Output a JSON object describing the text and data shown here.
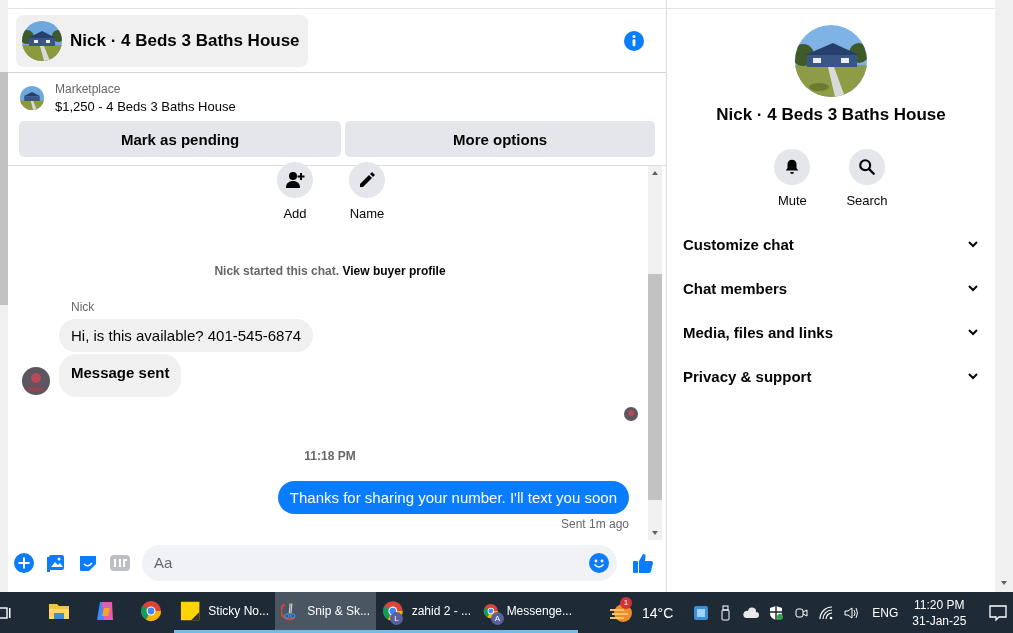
{
  "header": {
    "title": "Nick · 4 Beds 3 Baths House"
  },
  "listing": {
    "source": "Marketplace",
    "summary": "$1,250 - 4 Beds 3 Baths House",
    "buttons": [
      "Mark as pending",
      "More options"
    ]
  },
  "chat_actions": [
    {
      "label": "Add",
      "kind": "add"
    },
    {
      "label": "Name",
      "kind": "name"
    }
  ],
  "notice": {
    "text": "Nick started this chat.",
    "link": "View buyer profile"
  },
  "incoming": {
    "sender": "Nick",
    "messages": [
      {
        "kind": "text",
        "text": "Hi, is this available? 401-545-6874"
      },
      {
        "kind": "status",
        "text": "Message sent"
      }
    ]
  },
  "timestamp": "11:18 PM",
  "outgoing": {
    "text": "Thanks for sharing your number. I'll text you soon",
    "status": "Sent 1m ago"
  },
  "composer": {
    "placeholder": "Aa"
  },
  "profile": {
    "title": "Nick · 4 Beds 3 Baths House",
    "actions": [
      {
        "label": "Mute",
        "kind": "mute"
      },
      {
        "label": "Search",
        "kind": "search"
      }
    ],
    "sections": [
      {
        "label": "Customize chat",
        "expanded": false
      },
      {
        "label": "Chat members",
        "expanded": false
      },
      {
        "label": "Media, files and links",
        "expanded": false
      },
      {
        "label": "Privacy & support",
        "expanded": false
      }
    ]
  },
  "taskbar": {
    "apps": [
      {
        "kind": "explorer",
        "open": false,
        "selected": false
      },
      {
        "kind": "copilot",
        "open": false,
        "selected": false
      },
      {
        "kind": "chrome",
        "open": false,
        "selected": false
      },
      {
        "kind": "sticky",
        "label": "Sticky No...",
        "open": true,
        "selected": false
      },
      {
        "kind": "snip",
        "label": "Snip & Sk...",
        "open": true,
        "selected": true
      },
      {
        "kind": "chrome-profile",
        "label": "zahid 2 - ...",
        "badge": "L",
        "open": true,
        "selected": false
      },
      {
        "kind": "chrome-profile",
        "label": "Messenge...",
        "badge": "A",
        "open": true,
        "selected": false
      }
    ],
    "weather": {
      "badge": "1",
      "temperature": "14°C"
    },
    "language": "ENG",
    "time": "11:20 PM",
    "date": "31-Jan-25"
  }
}
